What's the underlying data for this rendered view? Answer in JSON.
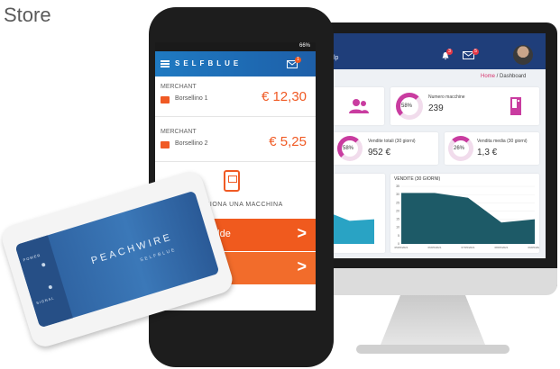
{
  "store": {
    "label": "Store"
  },
  "dashboard": {
    "help": "Help",
    "notification_count": "3",
    "mail_count": "5",
    "breadcrumb_home": "Home",
    "breadcrumb_sep": " / ",
    "breadcrumb_current": "Dashboard",
    "machines": {
      "percent": "58%",
      "label": "Numero macchine",
      "value": "239"
    },
    "sales_total": {
      "percent": "58%",
      "label": "Vendite totali (30 giorni)",
      "value": "952 €"
    },
    "sales_avg": {
      "percent": "26%",
      "label": "Vendita media (30 giorni)",
      "value": "1,3 €"
    },
    "sales_chart_title": "VENDITE (30 GIORNI)",
    "colors": {
      "header": "#1f3e7a",
      "accent": "#c93ca0",
      "chart_fill": "#1d5a67"
    }
  },
  "phone": {
    "status": "66%",
    "brand": "SELFBLUE",
    "mail_badge": "1",
    "wallets": [
      {
        "merchant": "MERCHANT",
        "name": "Borsellino 1",
        "amount": "€ 12,30"
      },
      {
        "merchant": "MERCHANT",
        "name": "Borsellino 2",
        "amount": "€ 5,25"
      }
    ],
    "select_machine": "SELEZIONA UNA MACCHINA",
    "buttons": [
      {
        "label": "ande calde",
        "arrow": ">"
      },
      {
        "label": "",
        "arrow": ">"
      }
    ],
    "colors": {
      "orange": "#f05a24",
      "app_bar": "#1f7ac2"
    }
  },
  "device": {
    "brand": "PEACHWIRE",
    "sub": "SELFBLUE",
    "power": "POWER",
    "signal": "SIGNAL"
  },
  "chart_data": [
    {
      "type": "area",
      "title": "",
      "x": [
        "1",
        "2",
        "3",
        "4"
      ],
      "values": [
        30,
        20,
        14,
        15
      ],
      "ylim": [
        0,
        35
      ]
    },
    {
      "type": "area",
      "title": "VENDITE (30 GIORNI)",
      "categories": [
        "05/05/2021",
        "06/05/2021",
        "07/05/2021",
        "08/05/2021",
        "09/05/2021"
      ],
      "values": [
        31,
        31,
        28,
        13,
        15
      ],
      "ylim": [
        0,
        35
      ],
      "yticks": [
        0,
        5,
        10,
        15,
        20,
        25,
        30,
        35
      ],
      "grid": true
    }
  ]
}
